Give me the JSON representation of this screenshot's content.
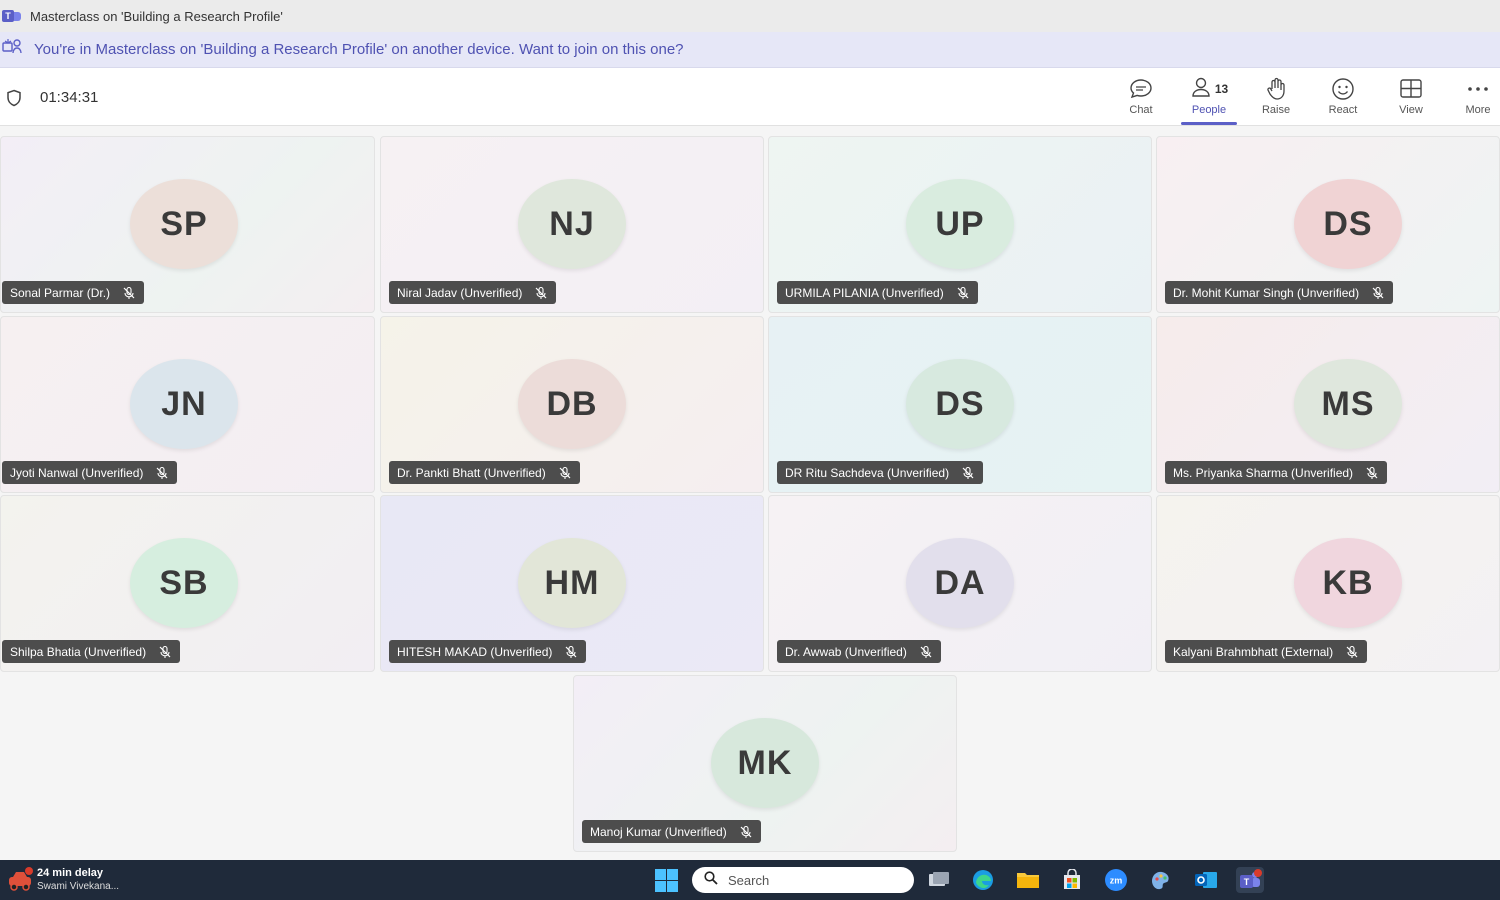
{
  "window": {
    "title": "Masterclass on 'Building a Research Profile'"
  },
  "banner": {
    "text": "You're in Masterclass on 'Building a Research Profile' on another device. Want to join on this one?"
  },
  "toolbar": {
    "timer": "01:34:31",
    "buttons": [
      {
        "label": "Chat",
        "icon": "chat-icon"
      },
      {
        "label": "People",
        "icon": "people-icon",
        "count": "13",
        "active": true
      },
      {
        "label": "Raise",
        "icon": "hand-icon"
      },
      {
        "label": "React",
        "icon": "smiley-icon"
      },
      {
        "label": "View",
        "icon": "grid-icon"
      },
      {
        "label": "More",
        "icon": "ellipsis-icon"
      }
    ]
  },
  "participants": [
    {
      "initials": "SP",
      "name": "Sonal Parmar (Dr.)",
      "avatar_color": "#ecdfd9"
    },
    {
      "initials": "NJ",
      "name": "Niral Jadav (Unverified)",
      "avatar_color": "#dfe7dc"
    },
    {
      "initials": "UP",
      "name": "URMILA PILANIA (Unverified)",
      "avatar_color": "#d9ecdf"
    },
    {
      "initials": "DS",
      "name": "Dr. Mohit Kumar Singh (Unverified)",
      "avatar_color": "#f0d3d4"
    },
    {
      "initials": "JN",
      "name": "Jyoti Nanwal (Unverified)",
      "avatar_color": "#dbe5ec"
    },
    {
      "initials": "DB",
      "name": "Dr. Pankti Bhatt (Unverified)",
      "avatar_color": "#ecdcd9"
    },
    {
      "initials": "DS",
      "name": "DR Ritu Sachdeva (Unverified)",
      "avatar_color": "#d7e9df"
    },
    {
      "initials": "MS",
      "name": "Ms. Priyanka Sharma (Unverified)",
      "avatar_color": "#dfe7dd"
    },
    {
      "initials": "SB",
      "name": "Shilpa Bhatia (Unverified)",
      "avatar_color": "#d6eedf"
    },
    {
      "initials": "HM",
      "name": "HITESH MAKAD (Unverified)",
      "avatar_color": "#e2e6d8"
    },
    {
      "initials": "DA",
      "name": "Dr. Awwab (Unverified)",
      "avatar_color": "#e2dfec"
    },
    {
      "initials": "KB",
      "name": "Kalyani Brahmbhatt (External)",
      "avatar_color": "#f0d6de"
    },
    {
      "initials": "MK",
      "name": "Manoj Kumar (Unverified)",
      "avatar_color": "#d7e8dc"
    }
  ],
  "taskbar": {
    "weather_line1": "24 min delay",
    "weather_line2": "Swami Vivekana...",
    "search_placeholder": "Search",
    "apps": [
      "task-view-icon",
      "edge-icon",
      "file-explorer-icon",
      "store-icon",
      "zoom-icon",
      "paint-icon",
      "outlook-icon",
      "teams-icon"
    ],
    "teams_badge": "9"
  }
}
